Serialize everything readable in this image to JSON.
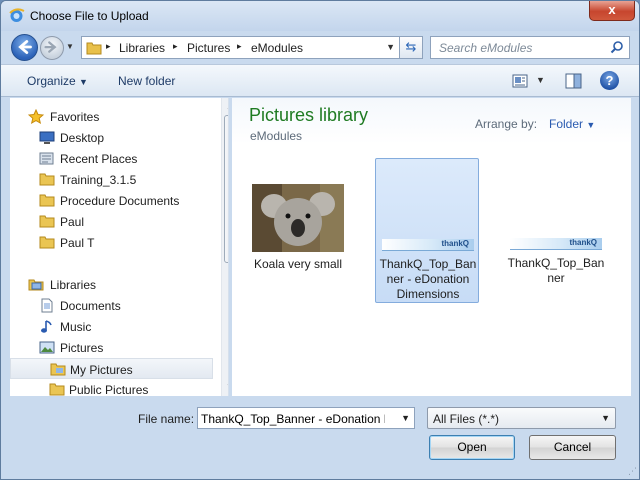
{
  "window": {
    "title": "Choose File to Upload",
    "close_label": "x"
  },
  "address_bar": {
    "segments": [
      "Libraries",
      "Pictures",
      "eModules"
    ],
    "separator": "▸"
  },
  "search": {
    "placeholder": "Search eModules"
  },
  "toolbar": {
    "organize_label": "Organize",
    "new_folder_label": "New folder",
    "help_label": "?"
  },
  "navigation": {
    "favorites": [
      {
        "label": "Favorites",
        "icon": "star-icon"
      },
      {
        "label": "Desktop",
        "icon": "desktop-icon"
      },
      {
        "label": "Recent Places",
        "icon": "recent-places-icon"
      },
      {
        "label": "Training_3.1.5",
        "icon": "folder-icon"
      },
      {
        "label": "Procedure Documents",
        "icon": "folder-icon"
      },
      {
        "label": "Paul",
        "icon": "folder-icon"
      },
      {
        "label": "Paul T",
        "icon": "folder-icon"
      }
    ],
    "libraries": [
      {
        "label": "Libraries",
        "icon": "libraries-icon"
      },
      {
        "label": "Documents",
        "icon": "documents-icon"
      },
      {
        "label": "Music",
        "icon": "music-icon"
      },
      {
        "label": "Pictures",
        "icon": "pictures-icon"
      },
      {
        "label": "My Pictures",
        "icon": "folder-icon",
        "selected": true
      },
      {
        "label": "Public Pictures",
        "icon": "folder-icon"
      }
    ]
  },
  "content": {
    "title": "Pictures library",
    "subtitle": "eModules",
    "arrange_by_label": "Arrange by:",
    "arrange_by_value": "Folder",
    "files": [
      {
        "name_lines": [
          "Koala very small"
        ],
        "thumb": "koala-image"
      },
      {
        "name_lines": [
          "ThankQ_Top_Ban",
          "ner - eDonation",
          "Dimensions"
        ],
        "thumb": "thankq-banner",
        "selected": true
      },
      {
        "name_lines": [
          "ThankQ_Top_Ban",
          "ner"
        ],
        "thumb": "thankq-banner"
      }
    ],
    "banner_text": "thankQ"
  },
  "footer": {
    "file_name_label": "File name:",
    "file_name_value": "ThankQ_Top_Banner - eDonation Dimensions",
    "file_type_value": "All Files (*.*)",
    "open_label": "Open",
    "cancel_label": "Cancel"
  },
  "colors": {
    "library_title": "#1f7b22",
    "link_blue": "#2a5bb0",
    "selection": "#c7dcf6"
  }
}
